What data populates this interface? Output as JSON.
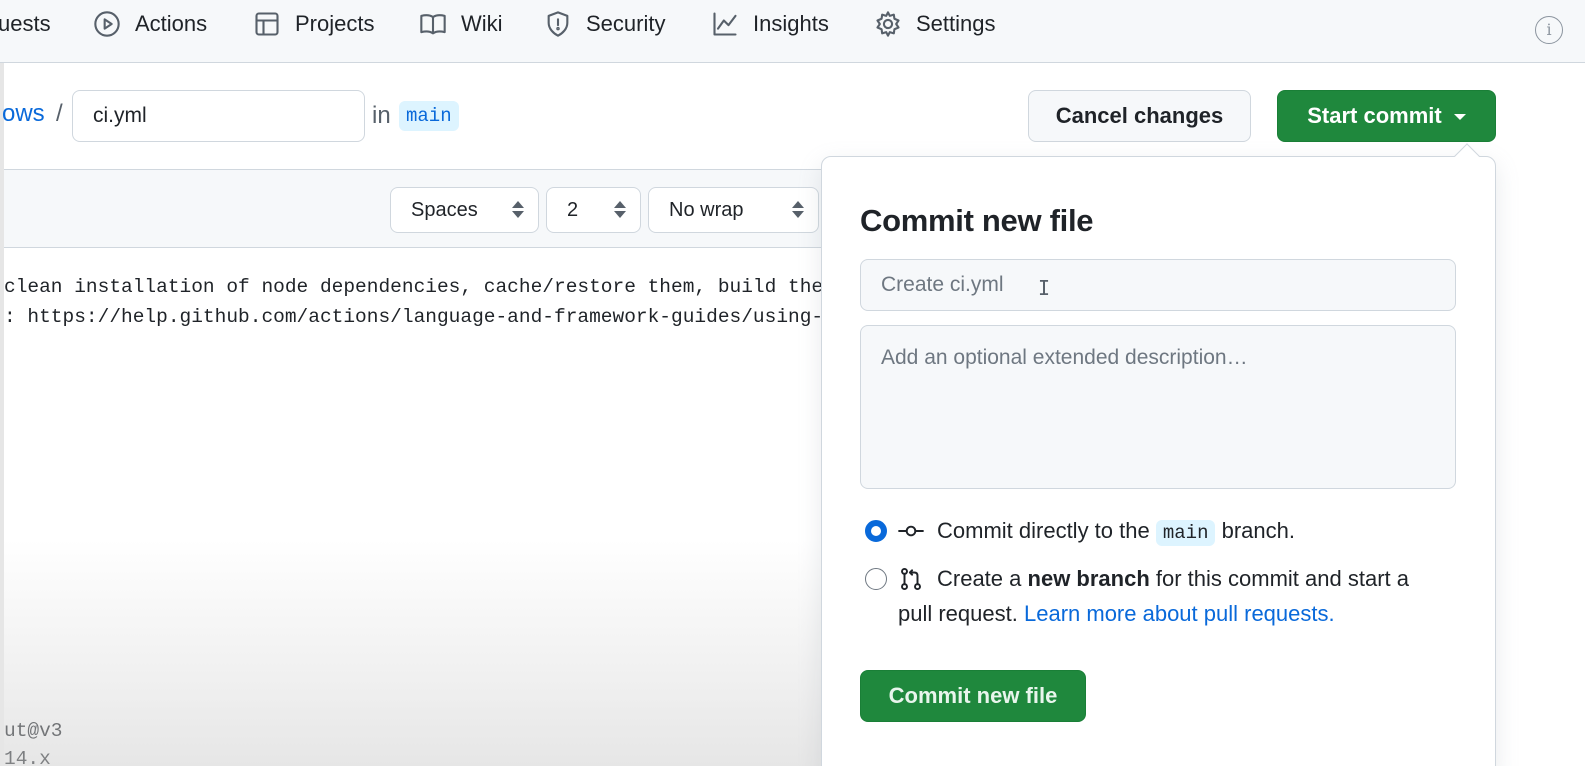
{
  "repo_nav": {
    "items": [
      {
        "label": "uests",
        "icon": "pull-request-icon"
      },
      {
        "label": "Actions",
        "icon": "play-icon"
      },
      {
        "label": "Projects",
        "icon": "table-icon"
      },
      {
        "label": "Wiki",
        "icon": "book-icon"
      },
      {
        "label": "Security",
        "icon": "shield-icon"
      },
      {
        "label": "Insights",
        "icon": "graph-icon"
      },
      {
        "label": "Settings",
        "icon": "gear-icon"
      }
    ],
    "info_glyph": "i"
  },
  "path_bar": {
    "crumb": "ows",
    "separator": "/",
    "filename": "ci.yml",
    "in_label": "in",
    "branch": "main"
  },
  "actions": {
    "cancel_label": "Cancel changes",
    "start_commit_label": "Start commit"
  },
  "editor": {
    "indent_mode": "Spaces",
    "indent_size": "2",
    "wrap_mode": "No wrap",
    "lines": [
      "clean installation of node dependencies, cache/restore them, build the",
      ": https://help.github.com/actions/language-and-framework-guides/using-",
      "ut@v3",
      "14.x"
    ]
  },
  "commit_panel": {
    "title": "Commit new file",
    "summary_placeholder": "Create ci.yml",
    "description_placeholder": "Add an optional extended description…",
    "option_direct": {
      "prefix": "Commit directly to the",
      "branch": "main",
      "suffix": "branch.",
      "selected": true
    },
    "option_new_branch": {
      "prefix": "Create a",
      "bold": "new branch",
      "suffix": "for this commit and start a",
      "line2": "pull request.",
      "link": "Learn more about pull requests.",
      "selected": false
    },
    "submit_label": "Commit new file"
  },
  "colors": {
    "primary_green": "#1f883d",
    "link_blue": "#0969da",
    "badge_bg": "#ddf4ff"
  }
}
